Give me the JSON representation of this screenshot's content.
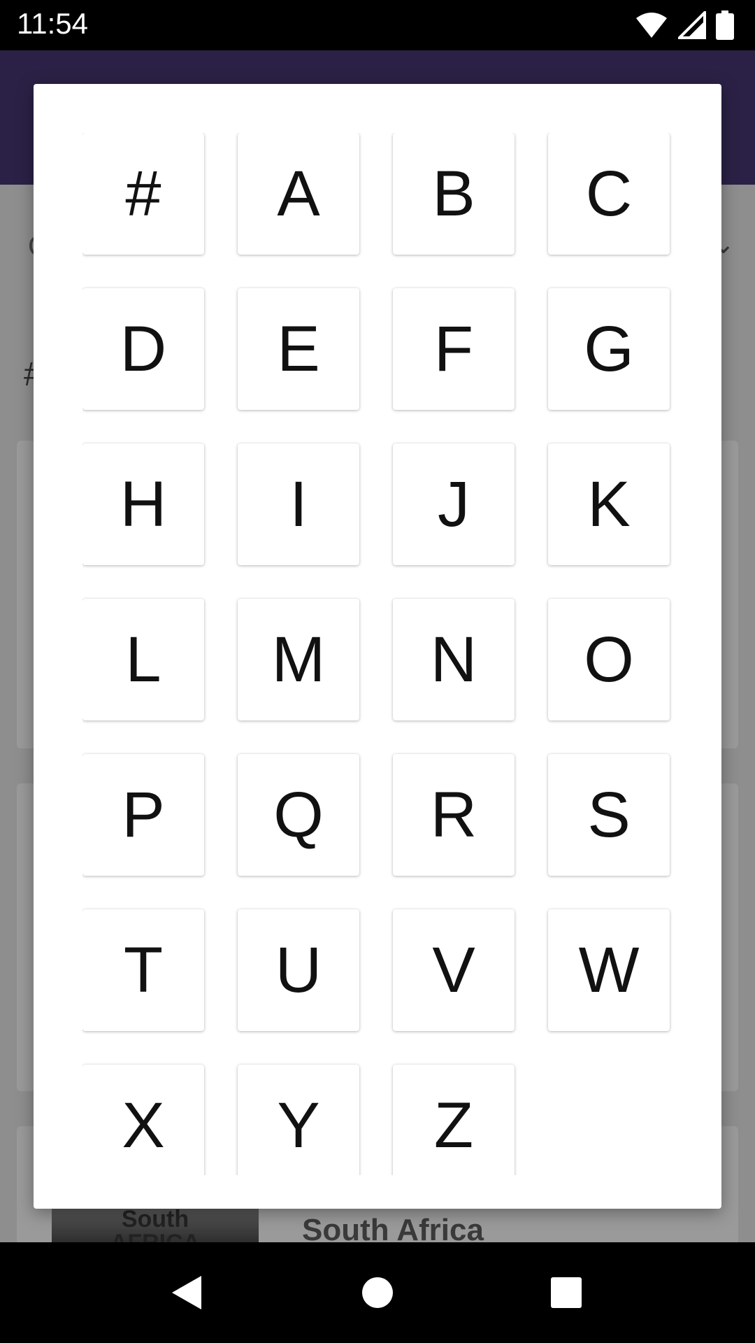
{
  "status_bar": {
    "time": "11:54"
  },
  "background": {
    "section_header": "#",
    "partial_letter": "C",
    "flag_text_line1": "South",
    "flag_text_line2": "AFRICA",
    "country_name": "South Africa"
  },
  "letters": [
    "#",
    "A",
    "B",
    "C",
    "D",
    "E",
    "F",
    "G",
    "H",
    "I",
    "J",
    "K",
    "L",
    "M",
    "N",
    "O",
    "P",
    "Q",
    "R",
    "S",
    "T",
    "U",
    "V",
    "W",
    "X",
    "Y",
    "Z"
  ],
  "icons": {
    "wifi": "wifi-icon",
    "signal": "cell-signal-icon",
    "battery": "battery-icon",
    "back": "back-icon",
    "home": "home-icon",
    "recents": "recents-icon"
  }
}
